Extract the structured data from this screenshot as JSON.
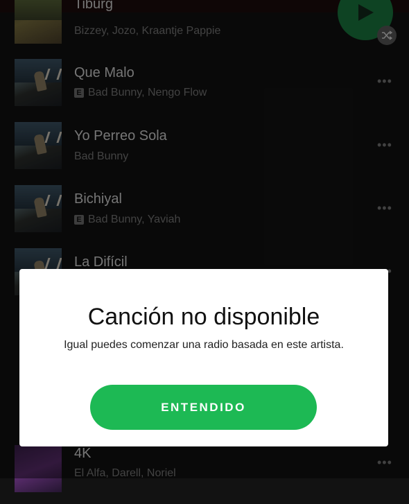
{
  "tracks": [
    {
      "title": "Tiburg",
      "artists": "Bizzey, Jozo, Kraantje Pappie",
      "explicit": false
    },
    {
      "title": "Que Malo",
      "artists": "Bad Bunny, Nengo Flow",
      "explicit": true
    },
    {
      "title": "Yo Perreo Sola",
      "artists": "Bad Bunny",
      "explicit": false
    },
    {
      "title": "Bichiyal",
      "artists": "Bad Bunny, Yaviah",
      "explicit": true
    },
    {
      "title": "La Difícil",
      "artists": "",
      "explicit": false
    },
    {
      "title": "4K",
      "artists": "El Alfa, Darell, Noriel",
      "explicit": false
    }
  ],
  "explicit_badge": "E",
  "more_icon": "•••",
  "dialog": {
    "title": "Canción no disponible",
    "message": "Igual puedes comenzar una radio basada en este artista.",
    "button_label": "ENTENDIDO"
  },
  "colors": {
    "accent": "#1db954",
    "background": "#121212",
    "dialog_bg": "#ffffff"
  }
}
